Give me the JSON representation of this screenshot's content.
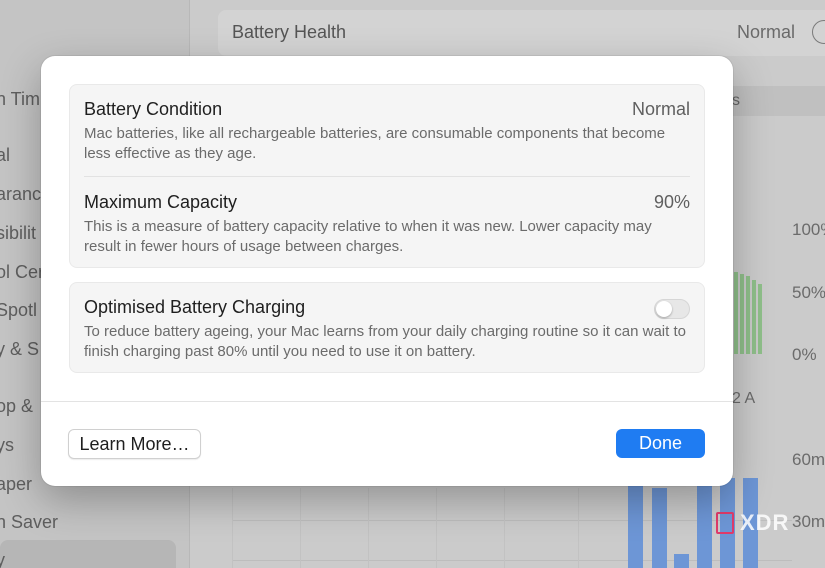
{
  "background": {
    "sidebar_items": [
      "n Tim",
      "al",
      "aranc",
      "sibilit",
      "ol Cer",
      "Spotl",
      "y & S",
      "op &",
      "ys",
      "aper",
      "n Saver",
      "y"
    ],
    "battery_health_label": "Battery Health",
    "battery_health_value": "Normal",
    "segment_text": "s",
    "axis_labels": [
      "100%",
      "50%",
      "0%",
      "60m",
      "30m"
    ],
    "time_label": "2 A"
  },
  "sheet": {
    "condition": {
      "title": "Battery Condition",
      "value": "Normal",
      "description": "Mac batteries, like all rechargeable batteries, are consumable components that become less effective as they age."
    },
    "capacity": {
      "title": "Maximum Capacity",
      "value": "90%",
      "description": "This is a measure of battery capacity relative to when it was new. Lower capacity may result in fewer hours of usage between charges."
    },
    "optimised": {
      "title": "Optimised Battery Charging",
      "description": "To reduce battery ageing, your Mac learns from your daily charging routine so it can wait to finish charging past 80% until you need to use it on battery.",
      "enabled": false
    },
    "learn_more_label": "Learn More…",
    "done_label": "Done"
  },
  "colors": {
    "accent": "#1f7cf2",
    "chart_green": "#8fbf8a",
    "chart_blue": "#6d96d6"
  },
  "watermark": "XDR"
}
